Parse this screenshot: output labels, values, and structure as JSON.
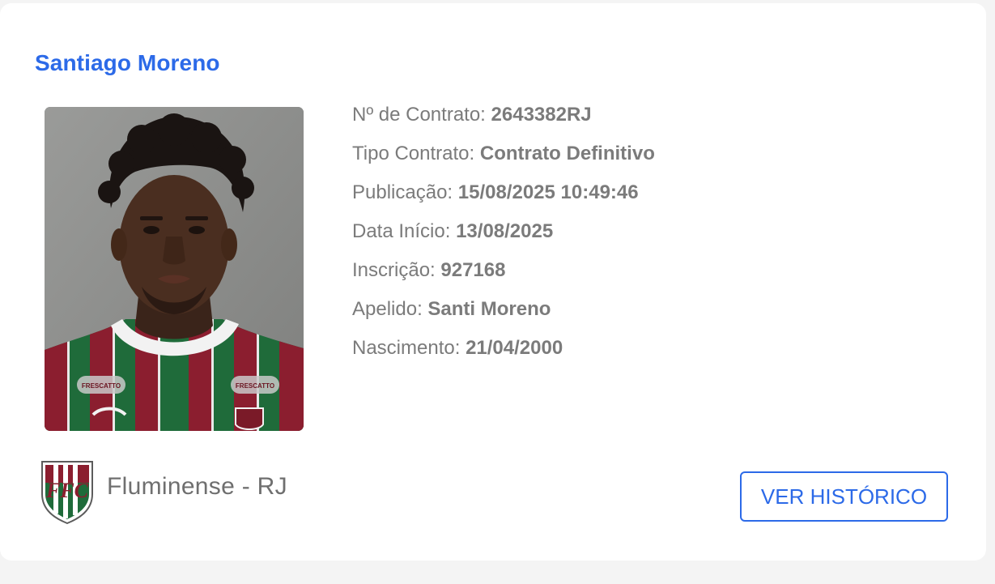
{
  "player": {
    "name": "Santiago Moreno"
  },
  "details": [
    {
      "label": "Nº de Contrato:",
      "value": "2643382RJ"
    },
    {
      "label": "Tipo Contrato:",
      "value": "Contrato Definitivo"
    },
    {
      "label": "Publicação:",
      "value": "15/08/2025 10:49:46"
    },
    {
      "label": "Data Início:",
      "value": "13/08/2025"
    },
    {
      "label": "Inscrição:",
      "value": "927168"
    },
    {
      "label": "Apelido:",
      "value": "Santi Moreno"
    },
    {
      "label": "Nascimento:",
      "value": "21/04/2000"
    }
  ],
  "club": {
    "name": "Fluminense - RJ",
    "crest_icon": "fluminense-crest-icon",
    "crest_lettering": "FFC",
    "colors": {
      "garnet": "#8b1e2f",
      "green": "#1f6b3a",
      "white": "#ffffff"
    }
  },
  "shirt_sponsor": "FRESCATTO",
  "actions": {
    "history_label": "VER HISTÓRICO"
  },
  "colors": {
    "accent": "#2c6ae8",
    "text_muted": "#7b7b7b",
    "background": "#f4f4f4",
    "card": "#ffffff"
  }
}
